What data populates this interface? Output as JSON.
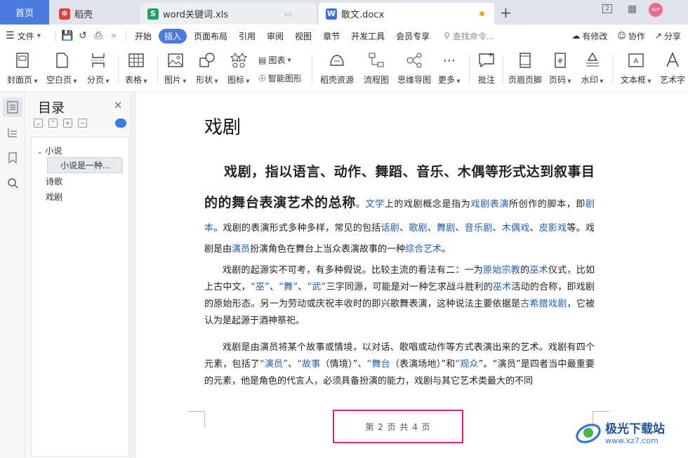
{
  "tabs": {
    "home": "首页",
    "daoke": "稻壳",
    "xls": "word关键词.xls",
    "active_doc": "散文.docx",
    "window_mode_badge": "2",
    "avatar_initials": "WP"
  },
  "menu": {
    "file": "文件",
    "tabs": [
      "开始",
      "插入",
      "页面布局",
      "引用",
      "审阅",
      "视图",
      "章节",
      "开发工具",
      "会员专享"
    ],
    "active_tab": "插入",
    "search_placeholder": "查找命令...",
    "changes": "有修改",
    "collab": "协作",
    "share": "分享"
  },
  "ribbon": {
    "cover": "封面页",
    "blank": "空白页",
    "pagebreak": "分页",
    "table": "表格",
    "picture": "图片",
    "shape": "形状",
    "icon": "图标",
    "chart": "图表",
    "smart": "智能图形",
    "daoke_res": "稻壳资源",
    "flowchart": "流程图",
    "mindmap": "思维导图",
    "more": "更多",
    "comment": "批注",
    "header_footer": "页眉页脚",
    "page_number": "页码",
    "watermark": "水印",
    "textbox": "文本框",
    "wordart": "艺术字"
  },
  "toc": {
    "title": "目录",
    "items": [
      "小说",
      "小说是一种...",
      "诗歌",
      "戏剧"
    ]
  },
  "doc": {
    "title": "戏剧",
    "p1_lead": "戏剧，指以语言、动作、舞蹈、音乐、木偶等形式达到叙事目的的舞台表演艺术的总称",
    "p1": [
      {
        "t": "。",
        "l": false
      },
      {
        "t": "文学",
        "l": true
      },
      {
        "t": "上的戏剧概念是指为",
        "l": false
      },
      {
        "t": "戏剧表演",
        "l": true
      },
      {
        "t": "所创作的脚本，即",
        "l": false
      },
      {
        "t": "剧本",
        "l": true
      },
      {
        "t": "。戏剧的表演形式多种多样，常见的包括",
        "l": false
      },
      {
        "t": "话剧",
        "l": true
      },
      {
        "t": "、",
        "l": false
      },
      {
        "t": "歌剧",
        "l": true
      },
      {
        "t": "、",
        "l": false
      },
      {
        "t": "舞剧",
        "l": true
      },
      {
        "t": "、",
        "l": false
      },
      {
        "t": "音乐剧",
        "l": true
      },
      {
        "t": "、",
        "l": false
      },
      {
        "t": "木偶戏",
        "l": true
      },
      {
        "t": "、",
        "l": false
      },
      {
        "t": "皮影戏",
        "l": true
      },
      {
        "t": "等。戏剧是由",
        "l": false
      },
      {
        "t": "演员",
        "l": true
      },
      {
        "t": "扮演角色在舞台上当众表演故事的一种",
        "l": false
      },
      {
        "t": "综合艺术",
        "l": true
      },
      {
        "t": "。",
        "l": false
      }
    ],
    "p2": [
      {
        "t": "戏剧的起源实不可考，有多种假说。比较主流的看法有二：一为",
        "l": false
      },
      {
        "t": "原始宗教",
        "l": true
      },
      {
        "t": "的",
        "l": false
      },
      {
        "t": "巫术",
        "l": true
      },
      {
        "t": "仪式，比如上古中文，",
        "l": false
      },
      {
        "t": "“巫”",
        "l": true
      },
      {
        "t": "、",
        "l": false
      },
      {
        "t": "“舞”",
        "l": true
      },
      {
        "t": "、",
        "l": false
      },
      {
        "t": "“武”",
        "l": true
      },
      {
        "t": "三字同源，可能是对一种乞求战斗胜利的",
        "l": false
      },
      {
        "t": "巫术",
        "l": true
      },
      {
        "t": "活动的合称，即戏剧的原始形态。另一为劳动或庆祝丰收时的即兴歌舞表演，这种说法主要依据是",
        "l": false
      },
      {
        "t": "古希腊戏剧",
        "l": true
      },
      {
        "t": "，它被认为是起源于酒神祭祀。",
        "l": false
      }
    ],
    "p3": [
      {
        "t": "戏剧是由演员将某个故事或情境，以对话、歌唱或动作等方式表演出来的艺术。戏剧有四个元素，包括了",
        "l": false
      },
      {
        "t": "“演员”",
        "l": true
      },
      {
        "t": "、",
        "l": false
      },
      {
        "t": "“故事",
        "l": true
      },
      {
        "t": "（情境）”、",
        "l": false
      },
      {
        "t": "“舞台",
        "l": true
      },
      {
        "t": "（表演场地）”和",
        "l": false
      },
      {
        "t": "“观众",
        "l": true
      },
      {
        "t": "”。“演员”是四者当中最重要的元素，他是角色的代言人，必须具备扮演的能力，戏剧与其它艺术类最大的不同",
        "l": false
      }
    ],
    "footer": "第 2 页 共 4 页"
  },
  "watermark_site": {
    "cn": "极光下载站",
    "en": "www.xz7.com"
  }
}
